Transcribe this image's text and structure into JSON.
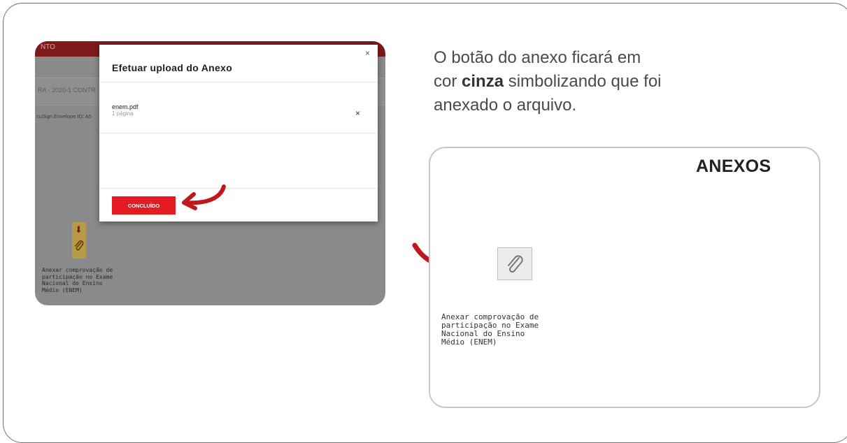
{
  "screenshot": {
    "topbar_text": "NTO",
    "breadcrumb": "RA - 2020-1 CONTR",
    "envelope_label": "cuSign Envelope ID: A5",
    "attachment_caption": "Anexar comprovação de\nparticipação no Exame\nNacional do Ensino\nMédio (ENEM)",
    "modal": {
      "title": "Efetuar upload do Anexo",
      "close": "×",
      "file_name": "enem.pdf",
      "file_pages": "1 página",
      "remove": "×",
      "done_button": "CONCLUÍDO"
    }
  },
  "description": {
    "line1": "O botão do anexo ficará em",
    "line2_prefix": "cor ",
    "line2_bold": "cinza",
    "line2_suffix": " simbolizando que foi",
    "line3": "anexado o arquivo."
  },
  "card": {
    "heading": "ANEXOS",
    "caption": "Anexar comprovação de\nparticipação no Exame\nNacional do Ensino\nMédio (ENEM)"
  },
  "colors": {
    "accent_red": "#c0181f",
    "button_red": "#e51b23",
    "attached_gray": "#ececec"
  },
  "icons": [
    "close-icon",
    "remove-file-icon",
    "download-arrow-icon",
    "paperclip-icon",
    "pointer-arrow"
  ]
}
